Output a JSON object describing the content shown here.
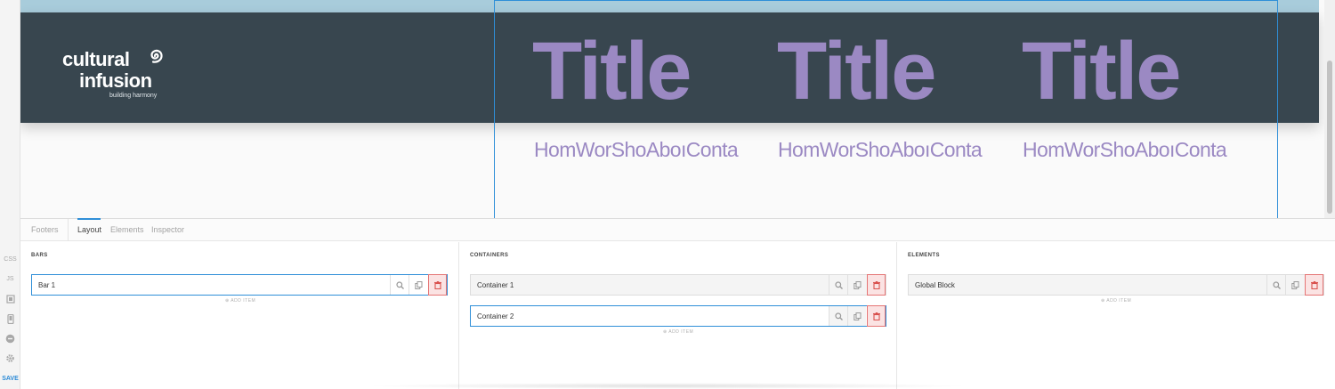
{
  "rail": {
    "css_label": "CSS",
    "js_label": "JS",
    "save_label": "SAVE"
  },
  "logo": {
    "line1": "cultural",
    "line2": "infusion",
    "tagline": "building harmony"
  },
  "preview": {
    "columns": [
      {
        "title": "Title",
        "menu": "HomWorShoAboıConta"
      },
      {
        "title": "Title",
        "menu": "HomWorShoAboıConta"
      },
      {
        "title": "Title",
        "menu": "HomWorShoAboıConta"
      }
    ]
  },
  "tabs": {
    "footers": "Footers",
    "layout": "Layout",
    "elements": "Elements",
    "inspector": "Inspector"
  },
  "bars": {
    "heading": "BARS",
    "items": [
      {
        "label": "Bar 1"
      }
    ],
    "add_label": "⊕ ADD ITEM"
  },
  "containers": {
    "heading": "CONTAINERS",
    "items": [
      {
        "label": "Container 1"
      },
      {
        "label": "Container 2"
      }
    ],
    "add_label": "⊕ ADD ITEM"
  },
  "elements": {
    "heading": "ELEMENTS",
    "items": [
      {
        "label": "Global Block"
      }
    ],
    "add_label": "⊕ ADD ITEM"
  },
  "colors": {
    "header_bg": "#38464f",
    "accent_purple": "#9b89c3",
    "selection_blue": "#2f8fd8",
    "delete_red": "#e57575"
  }
}
